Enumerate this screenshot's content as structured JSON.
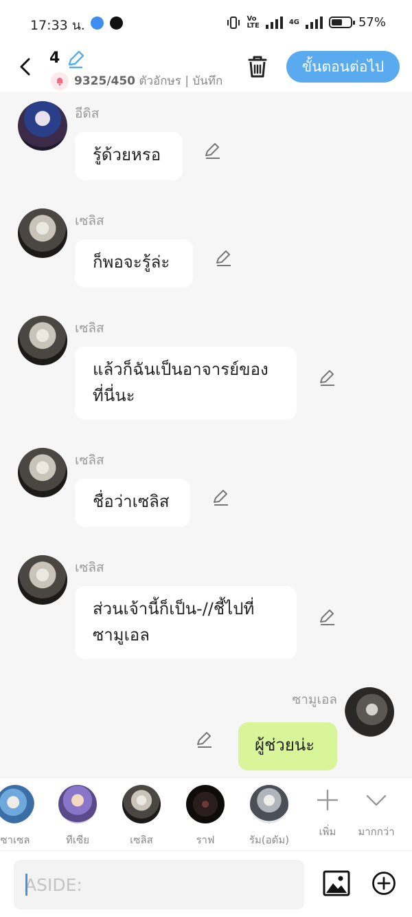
{
  "status_bar": {
    "time": "17:33 น.",
    "volte_label": "Vo\nLTE",
    "network": "4G",
    "battery": "57%",
    "battery_level": 0.57
  },
  "header": {
    "episode": "4",
    "counter_value": "9325/450",
    "counter_text": " ตัวอักษร | บันทึก",
    "next_button": "ขั้นตอนต่อไป",
    "accent_color": "#5aaaf0"
  },
  "messages": [
    {
      "sender": "อีดิส",
      "text": "รู้ด้วยหรอ",
      "avatar": "idis-avatar",
      "side": "left"
    },
    {
      "sender": "เซลิส",
      "text": "ก็พอจะรู้ล่ะ",
      "avatar": "selis-avatar",
      "side": "left"
    },
    {
      "sender": "เซลิส",
      "text_line1": "แล้วก็ฉันเป็นอาจารย์ของ",
      "text_line2": "ที่นี่นะ",
      "avatar": "selis-avatar",
      "side": "left"
    },
    {
      "sender": "เซลิส",
      "text": "ชื่อว่าเซลิส",
      "avatar": "selis-avatar",
      "side": "left"
    },
    {
      "sender": "เซลิส",
      "text_line1": "ส่วนเจ้านี้ก็เป็น-//ชี้ไปที่",
      "text_line2": "ซามูเอล",
      "avatar": "selis-avatar",
      "side": "left"
    },
    {
      "sender": "ซามูเอล",
      "text": "ผู้ช่วยน่ะ",
      "avatar": "samuel-avatar",
      "side": "right"
    }
  ],
  "characters": [
    {
      "name": "ซาเซล"
    },
    {
      "name": "ทีเซีย"
    },
    {
      "name": "เซลิส"
    },
    {
      "name": "ราฟ"
    },
    {
      "name": "รัม(อดัม)"
    }
  ],
  "tools": {
    "add_label": "เพิ่ม",
    "more_label": "มากกว่า"
  },
  "input": {
    "placeholder": "ASIDE:"
  },
  "colors": {
    "self_bubble": "#d8f59a",
    "other_bubble": "#ffffff"
  }
}
